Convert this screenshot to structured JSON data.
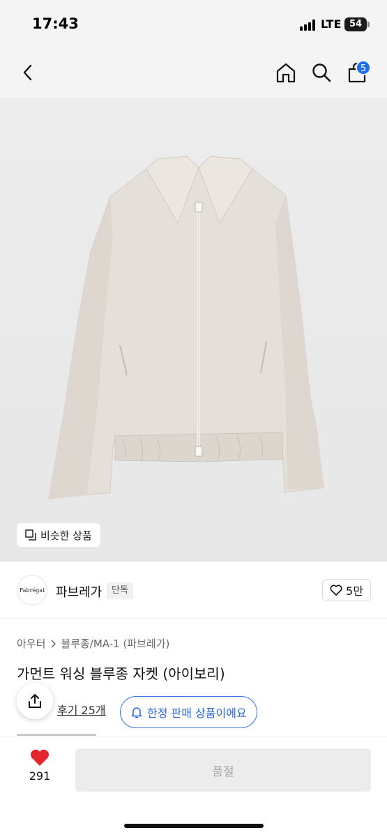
{
  "status_bar": {
    "time": "17:43",
    "network": "LTE",
    "battery": "54"
  },
  "nav": {
    "back_icon": "chevron-left-icon",
    "home_icon": "home-icon",
    "search_icon": "search-icon",
    "cart_icon": "shopping-bag-icon",
    "cart_count": "5"
  },
  "product_image": {
    "similar_label": "비슷한 상품"
  },
  "brand": {
    "logo_text": "Fabrégat",
    "name": "파브레가",
    "tag": "단독",
    "likes": "5만"
  },
  "breadcrumb": {
    "items": [
      "아우터",
      "블루종/MA-1 (파브레가)"
    ]
  },
  "product": {
    "title": "가먼트 워싱 블루종 자켓 (아이보리)",
    "review_text": "후기 25개",
    "limited_label": "한정 판매 상품이에요"
  },
  "bottom_bar": {
    "favorite_count": "291",
    "buy_label": "품절"
  },
  "colors": {
    "accent": "#2d67e0",
    "heart": "#e5262f",
    "badge": "#1f6fe5",
    "soldout_bg": "#ececec"
  }
}
